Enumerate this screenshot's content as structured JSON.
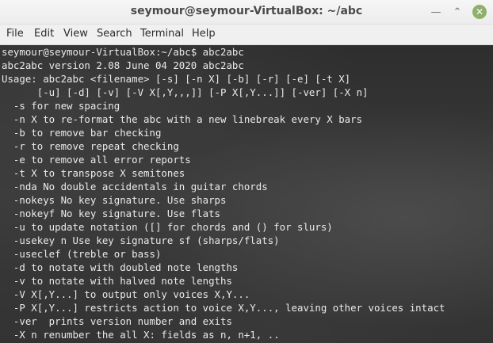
{
  "window": {
    "title": "seymour@seymour-VirtualBox: ~/abc",
    "buttons": {
      "minimize": "—",
      "maximize": "⌃",
      "close": "✕"
    }
  },
  "menu": [
    "File",
    "Edit",
    "View",
    "Search",
    "Terminal",
    "Help"
  ],
  "terminal": {
    "lines": [
      "seymour@seymour-VirtualBox:~/abc$ abc2abc",
      "abc2abc version 2.08 June 04 2020 abc2abc",
      "Usage: abc2abc <filename> [-s] [-n X] [-b] [-r] [-e] [-t X]",
      "      [-u] [-d] [-v] [-V X[,Y,,,]] [-P X[,Y...]] [-ver] [-X n]",
      "  -s for new spacing",
      "  -n X to re-format the abc with a new linebreak every X bars",
      "  -b to remove bar checking",
      "  -r to remove repeat checking",
      "  -e to remove all error reports",
      "  -t X to transpose X semitones",
      "  -nda No double accidentals in guitar chords",
      "  -nokeys No key signature. Use sharps",
      "  -nokeyf No key signature. Use flats",
      "  -u to update notation ([] for chords and () for slurs)",
      "  -usekey n Use key signature sf (sharps/flats)",
      "  -useclef (treble or bass)",
      "  -d to notate with doubled note lengths",
      "  -v to notate with halved note lengths",
      "  -V X[,Y...] to output only voices X,Y...",
      "  -P X[,Y...] restricts action to voice X,Y..., leaving other voices intact",
      "  -ver  prints version number and exits",
      "  -X n renumber the all X: fields as n, n+1, .."
    ]
  }
}
